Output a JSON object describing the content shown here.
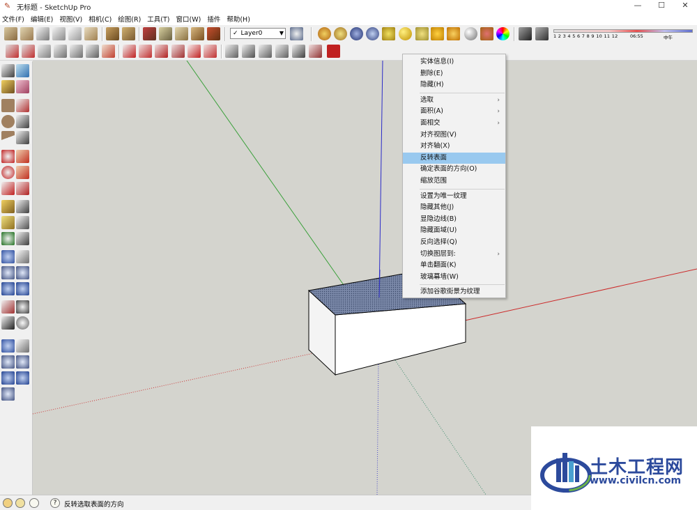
{
  "window": {
    "title": "无标题 - SketchUp Pro",
    "minimize": "—",
    "maximize": "☐",
    "close": "✕"
  },
  "menu": [
    "文件(F)",
    "编辑(E)",
    "视图(V)",
    "相机(C)",
    "绘图(R)",
    "工具(T)",
    "窗口(W)",
    "插件",
    "帮助(H)"
  ],
  "layer": {
    "check": "✓",
    "name": "Layer0"
  },
  "shadow_scale": {
    "numbers": "1 2 3 4 5 6 7 8 9 10 11 12",
    "time": "06:55",
    "noon": "中午"
  },
  "context_menu": {
    "groups": [
      [
        {
          "label": "实体信息(I)"
        },
        {
          "label": "删除(E)"
        },
        {
          "label": "隐藏(H)"
        }
      ],
      [
        {
          "label": "选取",
          "submenu": true
        },
        {
          "label": "面积(A)",
          "submenu": true
        },
        {
          "label": "面相交",
          "submenu": true
        },
        {
          "label": "对齐视图(V)"
        },
        {
          "label": "对齐轴(X)"
        },
        {
          "label": "反转表面",
          "selected": true
        },
        {
          "label": "确定表面的方向(O)"
        },
        {
          "label": "缩放范围"
        }
      ],
      [
        {
          "label": "设置为唯一纹理"
        },
        {
          "label": "隐藏其他(J)"
        },
        {
          "label": "显隐边线(B)"
        },
        {
          "label": "隐藏面域(U)"
        },
        {
          "label": "反向选择(Q)"
        },
        {
          "label": "切换图层到:",
          "submenu": true
        },
        {
          "label": "单击翻面(K)"
        },
        {
          "label": "玻璃幕墙(W)"
        }
      ],
      [
        {
          "label": "添加谷歌街景为纹理"
        }
      ]
    ],
    "submenu_glyph": "›"
  },
  "status": {
    "text": "反转选取表面的方向",
    "help_glyph": "?"
  },
  "watermark": {
    "name": "土木工程网",
    "url": "www.civilcn.com"
  },
  "colors": {
    "viewport_bg": "#d4d4ce",
    "axis_green": "#3aa03a",
    "axis_red": "#cc2a2a",
    "axis_blue": "#2a2ac8",
    "face_selected": "#8090b0",
    "menu_highlight": "#99c9ef",
    "brand_blue": "#2c4a9c"
  }
}
